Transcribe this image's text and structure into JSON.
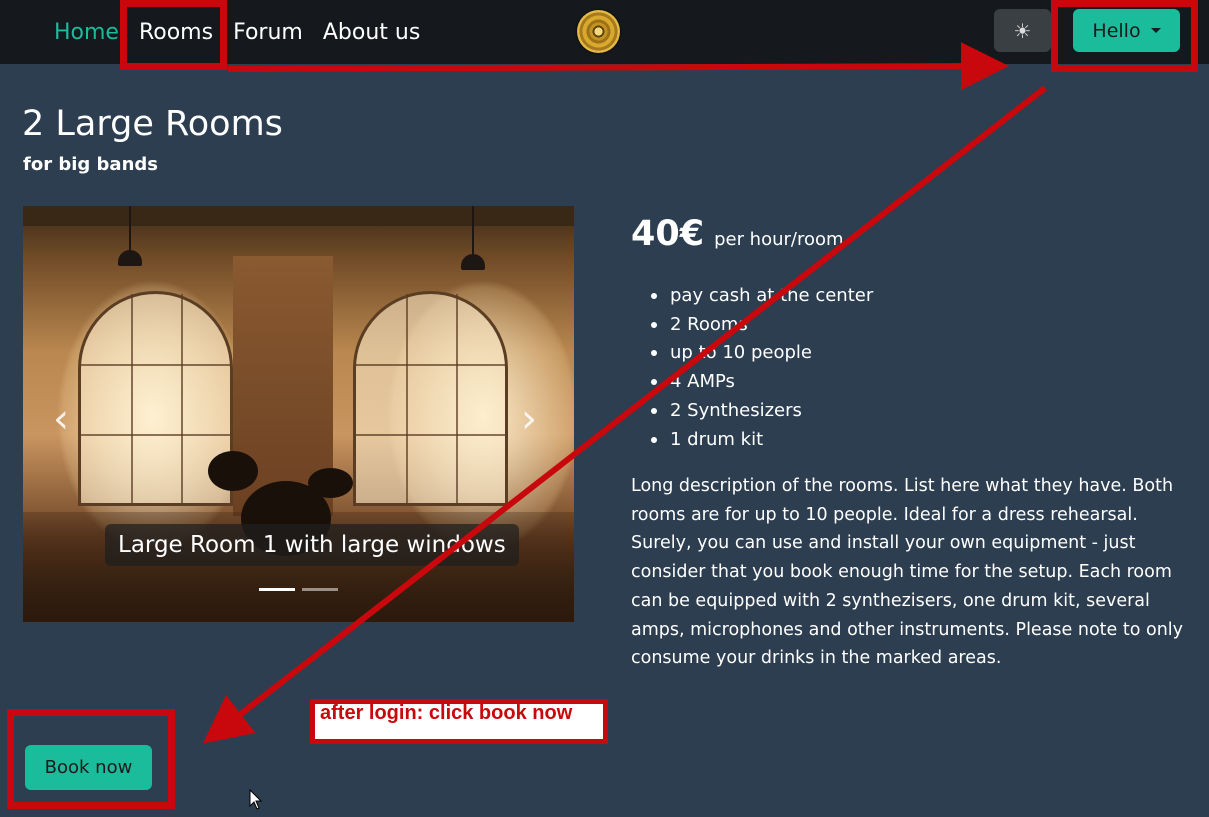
{
  "nav": {
    "links": [
      "Home",
      "Rooms",
      "Forum",
      "About us"
    ],
    "user_button": "Hello",
    "theme_icon": "sun-icon",
    "logo_icon": "golden-record-icon"
  },
  "page": {
    "title": "2 Large Rooms",
    "subtitle": "for big bands"
  },
  "carousel": {
    "caption": "Large Room 1 with large windows",
    "prev_icon": "chevron-left-icon",
    "next_icon": "chevron-right-icon",
    "slide_count": 2,
    "active_slide": 1
  },
  "pricing": {
    "price": "40€",
    "unit": "per hour/room"
  },
  "features": [
    "pay cash at the center",
    "2 Rooms",
    "up to 10 people",
    "4 AMPs",
    "2 Synthesizers",
    "1 drum kit"
  ],
  "description": "Long description of the rooms. List here what they have. Both rooms are for up to 10 people. Ideal for a dress rehearsal. Surely, you can use and install your own equipment - just consider that you book enough time for the setup. Each room can be equipped with 2 synthezisers, one drum kit, several amps, microphones and other instruments. Please note to only consume your drinks in the marked areas.",
  "actions": {
    "book_label": "Book now"
  },
  "annotation": {
    "note": "after login: click book now",
    "color": "#c8080c"
  },
  "colors": {
    "accent": "#1abc9c",
    "background": "#2c3e50",
    "navbar": "#15181c"
  }
}
